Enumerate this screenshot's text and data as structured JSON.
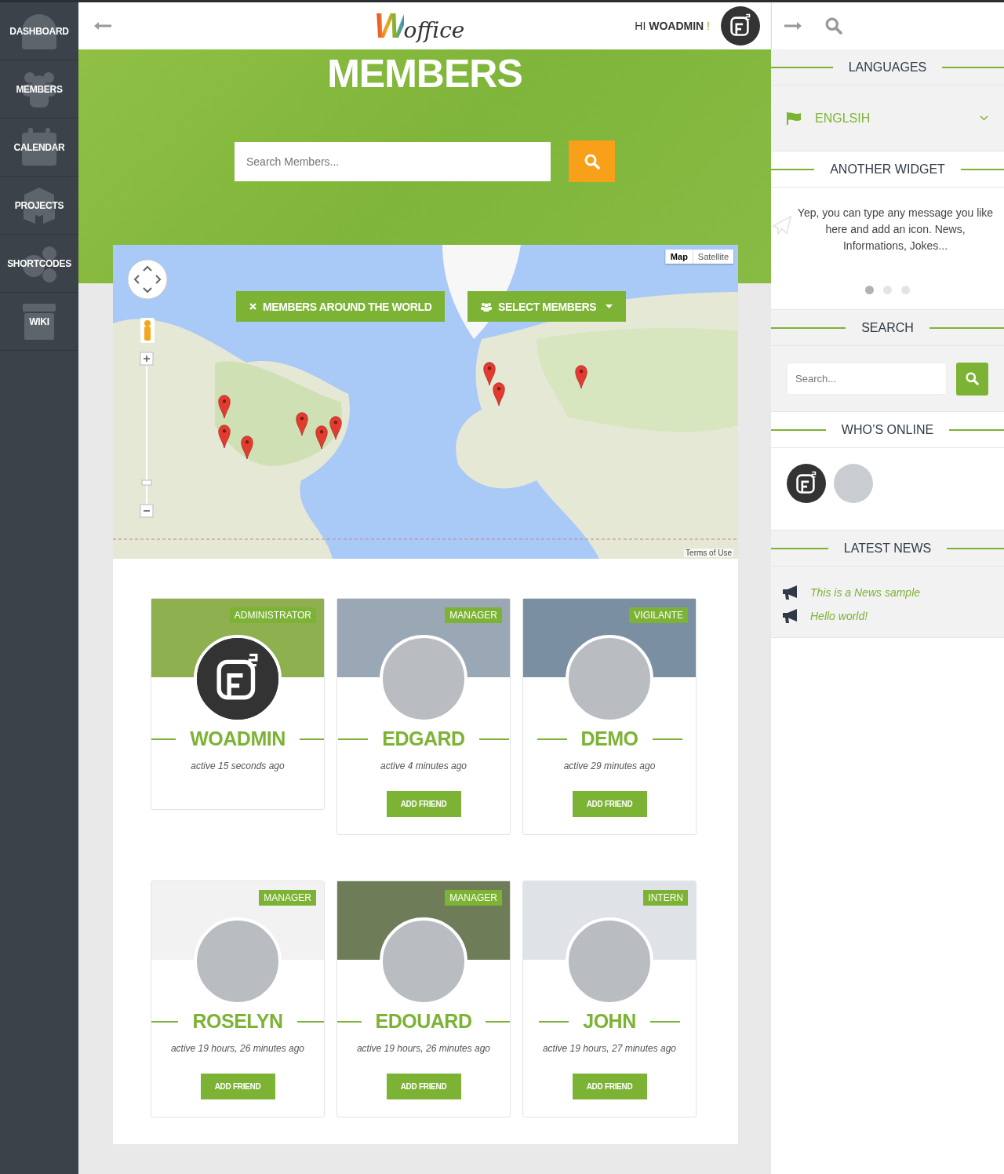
{
  "sidebar": {
    "items": [
      {
        "label": "DASHBOARD"
      },
      {
        "label": "MEMBERS"
      },
      {
        "label": "CALENDAR"
      },
      {
        "label": "PROJECTS"
      },
      {
        "label": "SHORTCODES"
      },
      {
        "label": "WIKI"
      }
    ]
  },
  "header": {
    "logo": {
      "mark": "W",
      "word": "office"
    },
    "greeting": {
      "prefix": "HI",
      "name": "WOADMIN",
      "suffix": "!"
    }
  },
  "hero": {
    "title": "MEMBERS",
    "search": {
      "placeholder": "Search Members..."
    }
  },
  "map": {
    "map_types": [
      {
        "label": "Map",
        "selected": true
      },
      {
        "label": "Satellite",
        "selected": false
      }
    ],
    "zoom": {
      "level": 0.15
    },
    "filter_button": "MEMBERS AROUND THE WORLD",
    "select_button": "SELECT MEMBERS",
    "terms": "Terms of Use"
  },
  "members": [
    {
      "name": "WOADMIN",
      "role": "ADMINISTRATOR",
      "active": "active 15 seconds ago",
      "logo_avatar": true,
      "cover_photo": true
    },
    {
      "name": "EDGARD",
      "role": "MANAGER",
      "active": "active 4 minutes ago",
      "logo_avatar": false,
      "cover_photo": true,
      "button": "ADD FRIEND"
    },
    {
      "name": "DEMO",
      "role": "VIGILANTE",
      "active": "active 29 minutes ago",
      "logo_avatar": false,
      "cover_photo": true,
      "button": "ADD FRIEND"
    },
    {
      "name": "ROSELYN",
      "role": "MANAGER",
      "active": "active 19 hours, 26 minutes ago",
      "logo_avatar": false,
      "cover_photo": false,
      "button": "ADD FRIEND"
    },
    {
      "name": "EDOUARD",
      "role": "MANAGER",
      "active": "active 19 hours, 26 minutes ago",
      "logo_avatar": false,
      "cover_photo": true,
      "button": "ADD FRIEND"
    },
    {
      "name": "JOHN",
      "role": "INTERN",
      "active": "active 19 hours, 27 minutes ago",
      "logo_avatar": false,
      "cover_photo": true,
      "button": "ADD FRIEND"
    }
  ],
  "right_sidebar": {
    "languages": {
      "title": "LANGUAGES",
      "value": "ENGLSIH"
    },
    "text_widget": {
      "title": "ANOTHER WIDGET",
      "text": "Yep, you can type any message you like here and add an icon. News, Informations, Jokes...",
      "dots": [
        {
          "selected": true
        },
        {
          "selected": false
        },
        {
          "selected": false
        }
      ]
    },
    "search": {
      "title": "SEARCH",
      "placeholder": "Search..."
    },
    "online": {
      "title": "WHO’S ONLINE",
      "users": [
        {
          "logo_avatar": true
        },
        {
          "logo_avatar": false
        }
      ]
    },
    "news": {
      "title": "LATEST NEWS",
      "items": [
        "This is a News sample",
        "Hello world!"
      ]
    }
  }
}
